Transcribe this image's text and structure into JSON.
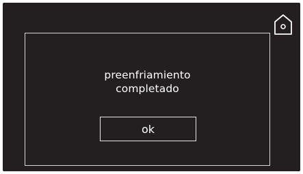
{
  "header": {
    "home_icon": "home-icon"
  },
  "dialog": {
    "message_line1": "preenfriamiento",
    "message_line2": "completado",
    "ok_label": "ok"
  },
  "colors": {
    "background": "#231f20",
    "foreground": "#ffffff",
    "border": "#d9d9d9"
  }
}
